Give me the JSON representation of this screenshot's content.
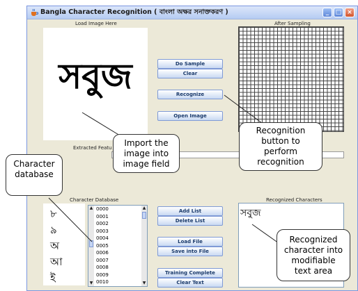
{
  "window": {
    "title": "Bangla Character Recognition ( বাংলা অক্ষর সনাক্তকরণ )",
    "controls": {
      "minimize": "_",
      "maximize": "□",
      "close": "×"
    }
  },
  "image_panel": {
    "caption": "Load Image Here",
    "word": "সবুজ"
  },
  "sampling_panel": {
    "caption": "After Sampling"
  },
  "buttons": {
    "do_sample": "Do Sample",
    "clear": "Clear",
    "recognize": "Recognize",
    "open_image": "Open Image",
    "add_list": "Add List",
    "delete_list": "Delete List",
    "load_file": "Load File",
    "save_into_file": "Save into File",
    "training_complete": "Training Complete",
    "clear_text": "Clear Text"
  },
  "extracted_features": {
    "caption": "Extracted Featu"
  },
  "character_database": {
    "caption": "Character Database",
    "characters": [
      "৮",
      "৯",
      "অ",
      "আ",
      "ই"
    ],
    "indices": [
      "0000",
      "0001",
      "0002",
      "0003",
      "0004",
      "0005",
      "0006",
      "0007",
      "0008",
      "0009",
      "0010"
    ]
  },
  "recognized_panel": {
    "caption": "Recognized Characters",
    "text": "সবুজ"
  },
  "callouts": {
    "import": "Import the\nimage into\nimage field",
    "recognition": "Recognition\nbutton to\nperform\nrecognition",
    "database": "Character\ndatabase",
    "recognized": "Recognized\ncharacter into\nmodifiable\ntext area"
  }
}
